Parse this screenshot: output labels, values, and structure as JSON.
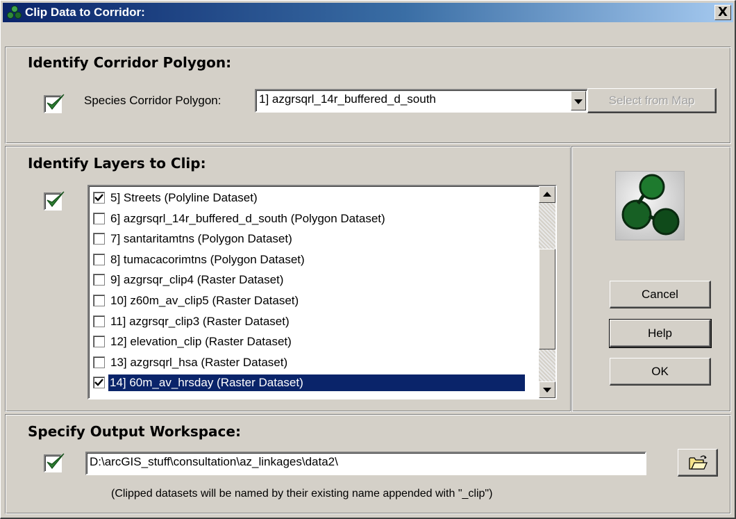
{
  "window": {
    "title": "Clip Data to Corridor:",
    "close_label": "X"
  },
  "corridor": {
    "heading": "Identify Corridor Polygon:",
    "field_label": "Species Corridor Polygon:",
    "selected_value": "1] azgrsqrl_14r_buffered_d_south",
    "select_from_map_label": "Select from Map"
  },
  "layers": {
    "heading": "Identify Layers to Clip:",
    "items": [
      {
        "label": "5] Streets  (Polyline Dataset)",
        "checked": true,
        "selected": false
      },
      {
        "label": "6] azgrsqrl_14r_buffered_d_south  (Polygon Dataset)",
        "checked": false,
        "selected": false
      },
      {
        "label": "7] santaritamtns  (Polygon Dataset)",
        "checked": false,
        "selected": false
      },
      {
        "label": "8] tumacacorimtns  (Polygon Dataset)",
        "checked": false,
        "selected": false
      },
      {
        "label": "9] azgrsqr_clip4 (Raster Dataset)",
        "checked": false,
        "selected": false
      },
      {
        "label": "10] z60m_av_clip5 (Raster Dataset)",
        "checked": false,
        "selected": false
      },
      {
        "label": "11] azgrsqr_clip3 (Raster Dataset)",
        "checked": false,
        "selected": false
      },
      {
        "label": "12] elevation_clip (Raster Dataset)",
        "checked": false,
        "selected": false
      },
      {
        "label": "13] azgrsqrl_hsa (Raster Dataset)",
        "checked": false,
        "selected": false
      },
      {
        "label": "14] 60m_av_hrsday (Raster Dataset)",
        "checked": true,
        "selected": true
      }
    ]
  },
  "actions": {
    "cancel_label": "Cancel",
    "help_label": "Help",
    "ok_label": "OK"
  },
  "output": {
    "heading": "Specify Output Workspace:",
    "path_value": "D:\\arcGIS_stuff\\consultation\\az_linkages\\data2\\",
    "note": "(Clipped datasets will be named by their existing name appended with \"_clip\")",
    "browse_icon": "open-folder-icon"
  },
  "colors": {
    "title_start": "#0a246a",
    "title_end": "#a6caf0",
    "check_green": "#2e7d32",
    "selection": "#0a246a"
  }
}
